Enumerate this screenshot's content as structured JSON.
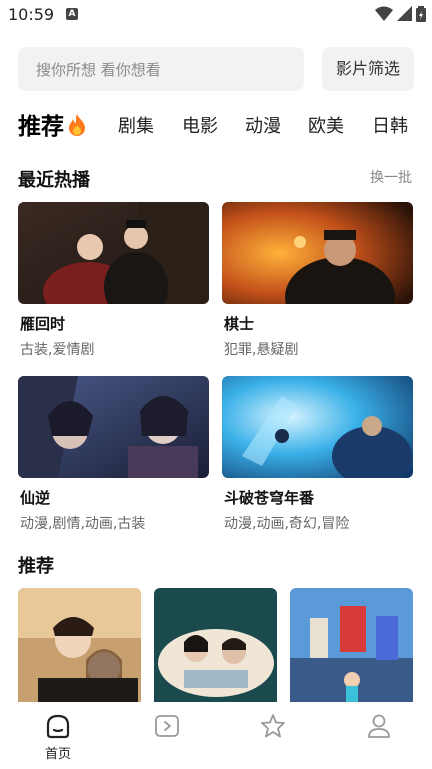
{
  "status_bar": {
    "time": "10:59",
    "notification_icon": "a-badge-icon",
    "icons": [
      "wifi-icon",
      "signal-icon",
      "battery-icon"
    ]
  },
  "search": {
    "placeholder": "搜你所想 看你想看",
    "filter_label": "影片筛选"
  },
  "tabs": [
    {
      "label": "推荐",
      "active": true,
      "icon": "fire-icon"
    },
    {
      "label": "剧集"
    },
    {
      "label": "电影"
    },
    {
      "label": "动漫"
    },
    {
      "label": "欧美"
    },
    {
      "label": "日韩"
    }
  ],
  "recent": {
    "title": "最近热播",
    "action": "换一批",
    "items": [
      {
        "title": "雁回时",
        "tags": "古装,爱情剧"
      },
      {
        "title": "棋士",
        "tags": "犯罪,悬疑剧"
      },
      {
        "title": "仙逆",
        "tags": "动漫,剧情,动画,古装"
      },
      {
        "title": "斗破苍穹年番",
        "tags": "动漫,动画,奇幻,冒险"
      }
    ]
  },
  "recommend": {
    "title": "推荐"
  },
  "bottom_nav": [
    {
      "label": "首页",
      "icon": "home-icon",
      "active": true
    },
    {
      "label": "",
      "icon": "play-icon"
    },
    {
      "label": "",
      "icon": "star-icon"
    },
    {
      "label": "",
      "icon": "user-icon"
    }
  ],
  "colors": {
    "accent": "#ff6a00",
    "text": "#111111",
    "muted": "#888888",
    "field_bg": "#f2f2f2"
  }
}
